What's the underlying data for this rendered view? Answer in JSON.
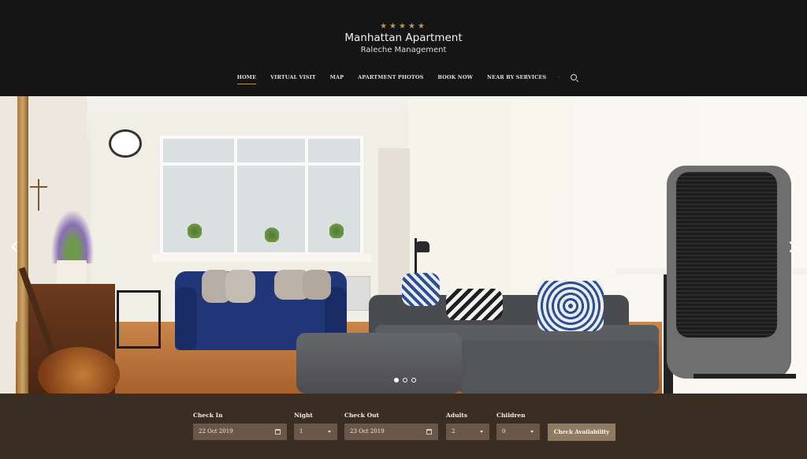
{
  "header": {
    "stars": "★★★★★",
    "title": "Manhattan Apartment",
    "subtitle": "Raleche Management",
    "nav": [
      {
        "label": "HOME",
        "active": true
      },
      {
        "label": "VIRTUAL VISIT"
      },
      {
        "label": "MAP"
      },
      {
        "label": "APARTMENT PHOTOS"
      },
      {
        "label": "BOOK NOW"
      },
      {
        "label": "NEAR BY SERVICES"
      }
    ],
    "nav_separator": "·",
    "search_icon": "search-icon"
  },
  "hero": {
    "slide_count": 3,
    "active_slide": 1,
    "prev_icon": "chevron-left-icon",
    "next_icon": "chevron-right-icon"
  },
  "booking": {
    "check_in": {
      "label": "Check In",
      "value": "22 Oct 2019",
      "icon": "calendar-icon"
    },
    "night": {
      "label": "Night",
      "value": "1",
      "icon": "chevron-down-icon"
    },
    "check_out": {
      "label": "Check Out",
      "value": "23 Oct 2019",
      "icon": "calendar-icon"
    },
    "adults": {
      "label": "Adults",
      "value": "2",
      "icon": "chevron-down-icon"
    },
    "children": {
      "label": "Children",
      "value": "0",
      "icon": "chevron-down-icon"
    },
    "submit_label": "Check Availability"
  },
  "colors": {
    "header_bg": "#151515",
    "accent": "#b8955a",
    "booking_bg": "#3a2e24",
    "field_bg": "#6b5747",
    "button_bg": "#8f7a63"
  }
}
